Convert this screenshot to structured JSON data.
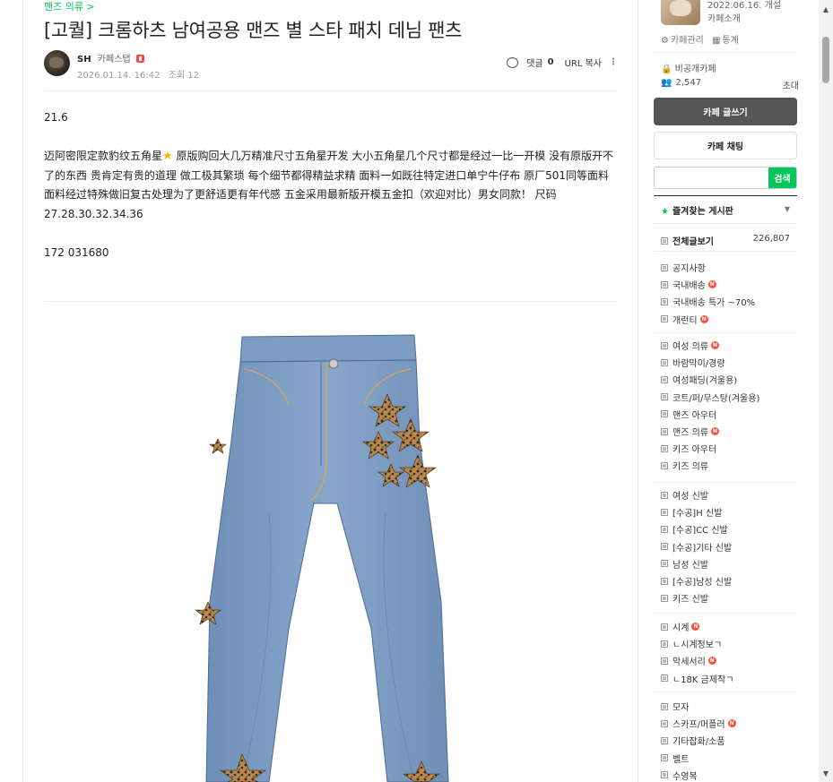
{
  "article": {
    "breadcrumb": "맨즈 의류 >",
    "title": "[고퀄] 크롬하츠 남여공용 맨즈 별 스타 패치 데님 팬츠",
    "author": "SH",
    "grade": "카페스탭",
    "date": "2026.01.14. 16:42",
    "views": "조회 12",
    "comment_label": "댓글",
    "comment_count": "0",
    "url_copy": "URL 복사",
    "more": "⋮",
    "body": {
      "line1": "21.6",
      "para_a": "迈阿密限定款豹纹五角星",
      "para_b": " 原版购回大几万精准尺寸五角星开发 大小五角星几个尺寸都是经过一比一开模 没有原版开不了的东西 贵肯定有贵的道理 做工极其繁琐 每个细节都得精益求精 面料一如既往特定进口单宁牛仔布 原厂501同等面料 面料经过特殊做旧复古处理为了更舒适更有年代感 五金采用最新版开模五金扣（欢迎对比）男女同款！ 尺码 27.28.30.32.34.36",
      "line3": "172 031680"
    }
  },
  "sidebar": {
    "cafe_date": "2022.06.16. 개설",
    "cafe_intro": "카페소개",
    "manage": "카페관리",
    "stats": "통계",
    "private": "비공개카페",
    "member_count": "2,547",
    "invite": "초대",
    "write_btn": "카페 글쓰기",
    "chat_btn": "카페 채팅",
    "search_btn": "검색",
    "search_placeholder": "",
    "favorites": "즐겨찾는 게시판",
    "all_posts": "전체글보기",
    "all_count": "226,807",
    "new_mark": "N",
    "groups": [
      [
        {
          "label": "공지사항",
          "new": false
        },
        {
          "label": "국내배송",
          "new": true
        },
        {
          "label": "국내배송 특가 ~70%",
          "new": false
        },
        {
          "label": "개런티",
          "new": true
        }
      ],
      [
        {
          "label": "여성 의류",
          "new": true
        },
        {
          "label": "바람막이/경량",
          "new": false
        },
        {
          "label": "여성패딩(겨울용)",
          "new": false
        },
        {
          "label": "코트/퍼/무스탕(겨울용)",
          "new": false
        },
        {
          "label": "맨즈 아우터",
          "new": false
        },
        {
          "label": "맨즈 의류",
          "new": true
        },
        {
          "label": "키즈 아우터",
          "new": false
        },
        {
          "label": "키즈 의류",
          "new": false
        }
      ],
      [
        {
          "label": "여성 신발",
          "new": false
        },
        {
          "label": "[수공]H 신발",
          "new": false
        },
        {
          "label": "[수공]CC 신발",
          "new": false
        },
        {
          "label": "[수공]기타 신발",
          "new": false
        },
        {
          "label": "남성 신발",
          "new": false
        },
        {
          "label": "[수공]남성 신발",
          "new": false
        },
        {
          "label": "키즈 신발",
          "new": false
        }
      ],
      [
        {
          "label": "시계",
          "new": true
        },
        {
          "label": "ㄴ시계정보ㄱ",
          "new": false
        },
        {
          "label": "악세서리",
          "new": true
        },
        {
          "label": "ㄴ18K 금제작ㄱ",
          "new": false
        }
      ],
      [
        {
          "label": "모자",
          "new": false
        },
        {
          "label": "스카프/머플러",
          "new": true
        },
        {
          "label": "기타잡화/소품",
          "new": false
        },
        {
          "label": "벨트",
          "new": false
        },
        {
          "label": "수영복",
          "new": false
        }
      ]
    ]
  },
  "colors": {
    "accent": "#03c75a",
    "new_badge": "#ff4e3f",
    "write_button": "#555555"
  },
  "icons": {
    "comment": "speech-bubble-icon",
    "star": "star-icon",
    "scroll_up": "triangle-up-icon",
    "scroll_down": "triangle-down-icon"
  }
}
